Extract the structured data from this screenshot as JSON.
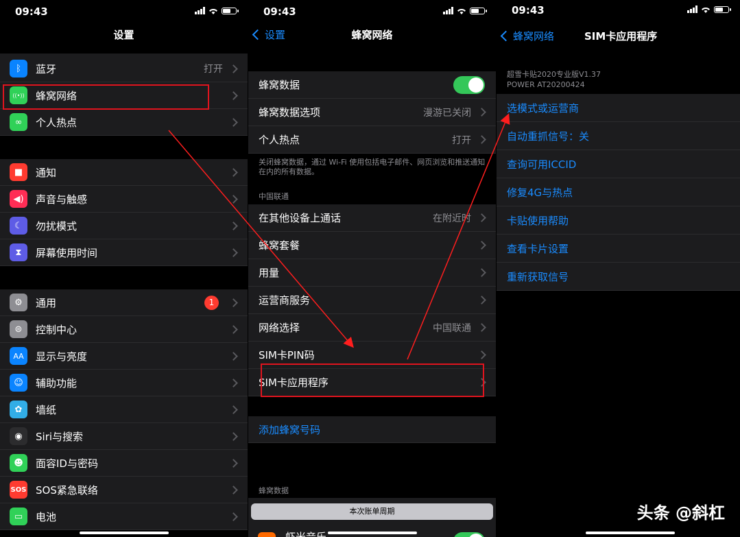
{
  "status": {
    "time": "09:43"
  },
  "p1": {
    "title": "设置",
    "group1": [
      {
        "label": "蓝牙",
        "value": "打开",
        "icon": "bluetooth-icon",
        "color": "#0a84ff"
      },
      {
        "label": "蜂窝网络",
        "value": "",
        "icon": "antenna-icon",
        "color": "#30d158"
      },
      {
        "label": "个人热点",
        "value": "",
        "icon": "link-icon",
        "color": "#30d158"
      }
    ],
    "group2": [
      {
        "label": "通知",
        "icon": "notification-icon",
        "color": "#ff3b30"
      },
      {
        "label": "声音与触感",
        "icon": "speaker-icon",
        "color": "#ff2d55"
      },
      {
        "label": "勿扰模式",
        "icon": "moon-icon",
        "color": "#5e5ce6"
      },
      {
        "label": "屏幕使用时间",
        "icon": "hourglass-icon",
        "color": "#5e5ce6"
      }
    ],
    "group3": [
      {
        "label": "通用",
        "badge": "1",
        "icon": "gear-icon",
        "color": "#8e8e93"
      },
      {
        "label": "控制中心",
        "icon": "switches-icon",
        "color": "#8e8e93"
      },
      {
        "label": "显示与亮度",
        "icon": "text-size-icon",
        "color": "#0a84ff"
      },
      {
        "label": "辅助功能",
        "icon": "accessibility-icon",
        "color": "#0a84ff"
      },
      {
        "label": "墙纸",
        "icon": "flower-icon",
        "color": "#32ade6"
      },
      {
        "label": "Siri与搜索",
        "icon": "siri-icon",
        "color": "#2c2c2e"
      },
      {
        "label": "面容ID与密码",
        "icon": "face-id-icon",
        "color": "#30d158"
      },
      {
        "label": "SOS紧急联络",
        "icon": "sos-icon",
        "color": "#ff3b30"
      },
      {
        "label": "电池",
        "icon": "battery-icon",
        "color": "#30d158"
      }
    ],
    "sos_glyph": "SOS",
    "aa_glyph": "AA"
  },
  "p2": {
    "back": "设置",
    "title": "蜂窝网络",
    "rows1": [
      {
        "label": "蜂窝数据",
        "toggle": true
      },
      {
        "label": "蜂窝数据选项",
        "value": "漫游已关闭"
      },
      {
        "label": "个人热点",
        "value": "打开"
      }
    ],
    "note": "关闭蜂窝数据，通过 Wi-Fi 使用包括电子邮件、网页浏览和推送通知在内的所有数据。",
    "section": "中国联通",
    "rows2": [
      {
        "label": "在其他设备上通话",
        "value": "在附近时"
      },
      {
        "label": "蜂窝套餐",
        "value": ""
      },
      {
        "label": "用量",
        "value": ""
      },
      {
        "label": "运营商服务",
        "value": ""
      },
      {
        "label": "网络选择",
        "value": "中国联通"
      },
      {
        "label": "SIM卡PIN码",
        "value": ""
      },
      {
        "label": "SIM卡应用程序",
        "value": ""
      }
    ],
    "add_line": "添加蜂窝号码",
    "section2": "蜂窝数据",
    "period_button": "本次账单周期",
    "partial_row": "虾米音乐"
  },
  "p3": {
    "back": "蜂窝网络",
    "title": "SIM卡应用程序",
    "info1": "超雪卡贴2020专业版V1.37",
    "info2": "POWER AT20200424",
    "items": [
      "选模式或运营商",
      "自动重抓信号：关",
      "查询可用ICCID",
      "修复4G与热点",
      "卡贴使用帮助",
      "查看卡片设置",
      "重新获取信号"
    ]
  },
  "watermark": "头条 @斜杠"
}
